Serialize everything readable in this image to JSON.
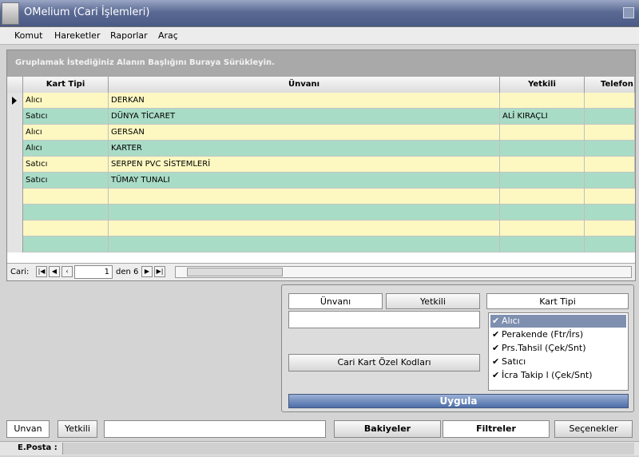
{
  "window": {
    "title": "OMelium (Cari İşlemleri)"
  },
  "menu": [
    {
      "label": "Komut"
    },
    {
      "label": "Hareketler"
    },
    {
      "label": "Raporlar"
    },
    {
      "label": "Araç"
    }
  ],
  "grid": {
    "group_hint": "Gruplamak İstediğiniz Alanın Başlığını Buraya Sürükleyin.",
    "columns": [
      "Kart Tipi",
      "Ünvanı",
      "Yetkili",
      "Telefon"
    ],
    "rows": [
      {
        "kart_tipi": "Alıcı",
        "unvan": "DERKAN",
        "yetkili": "",
        "telefon": ""
      },
      {
        "kart_tipi": "Satıcı",
        "unvan": "DÜNYA TİCARET",
        "yetkili": "ALİ KIRAÇLI",
        "telefon": ""
      },
      {
        "kart_tipi": "Alıcı",
        "unvan": "GERSAN",
        "yetkili": "",
        "telefon": ""
      },
      {
        "kart_tipi": "Alıcı",
        "unvan": "KARTER",
        "yetkili": "",
        "telefon": ""
      },
      {
        "kart_tipi": "Satıcı",
        "unvan": "SERPEN PVC SİSTEMLERİ",
        "yetkili": "",
        "telefon": ""
      },
      {
        "kart_tipi": "Satıcı",
        "unvan": "TÜMAY TUNALI",
        "yetkili": "",
        "telefon": ""
      }
    ]
  },
  "navigator": {
    "label": "Cari:",
    "current": "1",
    "count": "den 6"
  },
  "filters": {
    "tabs": [
      "Ünvanı",
      "Yetkili",
      "Kart Tipi"
    ],
    "special_codes_button": "Cari Kart Özel Kodları",
    "card_types": [
      {
        "label": "Alıcı",
        "checked": true,
        "selected": true
      },
      {
        "label": "Perakende (Ftr/İrs)",
        "checked": true,
        "selected": false
      },
      {
        "label": "Prs.Tahsil (Çek/Snt)",
        "checked": true,
        "selected": false
      },
      {
        "label": "Satıcı",
        "checked": true,
        "selected": false
      },
      {
        "label": "İcra Takip l (Çek/Snt)",
        "checked": true,
        "selected": false
      }
    ],
    "apply_button": "Uygula"
  },
  "bottom": {
    "tabs": [
      "Unvan",
      "Yetkili"
    ],
    "buttons": [
      "Bakiyeler",
      "Filtreler",
      "Seçenekler"
    ],
    "status_label": "E.Posta :"
  },
  "colors": {
    "row_yellow": "#fdf8c2",
    "row_green": "#a9dcc6",
    "apply_blue": "#4d6ea8"
  }
}
